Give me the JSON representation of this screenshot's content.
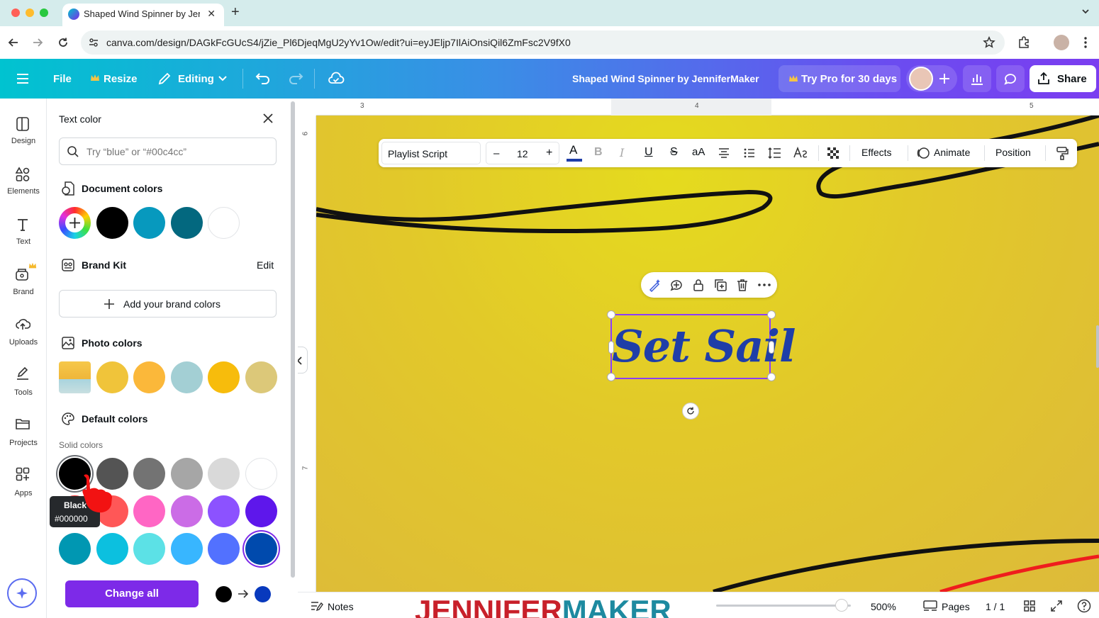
{
  "browser": {
    "tab_title": "Shaped Wind Spinner by Jen",
    "url": "canva.com/design/DAGkFcGUcS4/jZie_Pl6DjeqMgU2yYv1Ow/edit?ui=eyJEljp7IlAiOnsiQil6ZmFsc2V9fX0"
  },
  "header": {
    "file": "File",
    "resize": "Resize",
    "editing": "Editing",
    "doc_title": "Shaped Wind Spinner by JenniferMaker",
    "try_pro": "Try Pro for 30 days",
    "share": "Share"
  },
  "rail": {
    "items": [
      {
        "label": "Design"
      },
      {
        "label": "Elements"
      },
      {
        "label": "Text"
      },
      {
        "label": "Brand"
      },
      {
        "label": "Uploads"
      },
      {
        "label": "Tools"
      },
      {
        "label": "Projects"
      },
      {
        "label": "Apps"
      }
    ]
  },
  "panel": {
    "title": "Text color",
    "search_placeholder": "Try “blue” or “#00c4cc”",
    "document_colors": {
      "heading": "Document colors",
      "swatches": [
        "#000000",
        "#0799be",
        "#03687f",
        "#ffffff"
      ]
    },
    "brand_kit": {
      "heading": "Brand Kit",
      "edit": "Edit",
      "add_button": "Add your brand colors"
    },
    "photo_colors": {
      "heading": "Photo colors",
      "swatches": [
        "#f0c43a",
        "#fbb83a",
        "#a3cfd4",
        "#f7bc0c",
        "#dcc879"
      ]
    },
    "default_colors": {
      "heading": "Default colors",
      "subheading": "Solid colors",
      "rows": [
        [
          "#000000",
          "#545454",
          "#737373",
          "#a6a6a6",
          "#d9d9d9",
          "#ffffff"
        ],
        [
          "#ff3131",
          "#ff5757",
          "#ff66c4",
          "#cb6ce6",
          "#8c52ff",
          "#5e17eb"
        ],
        [
          "#0097b2",
          "#0cc0df",
          "#5ce1e6",
          "#38b6ff",
          "#5271ff",
          "#004aad"
        ]
      ]
    },
    "tooltip": {
      "name": "Black",
      "hex": "#000000"
    },
    "change_all": "Change all",
    "change_from": "#000000",
    "change_to": "#0839bd"
  },
  "ruler": {
    "top_marks": [
      "3",
      "4",
      "5"
    ],
    "left_marks": [
      "6",
      "7"
    ]
  },
  "text_toolbar": {
    "font": "Playlist Script",
    "size": "12",
    "effects": "Effects",
    "animate": "Animate",
    "position": "Position"
  },
  "canvas": {
    "text": "Set Sail",
    "text_color": "#1f3ea8"
  },
  "footer": {
    "notes": "Notes",
    "zoom": "500%",
    "zoom_level": 0.93,
    "pages": "Pages",
    "page_count": "1 / 1",
    "watermark_a": "JENNIFER",
    "watermark_b": "MAKER"
  }
}
